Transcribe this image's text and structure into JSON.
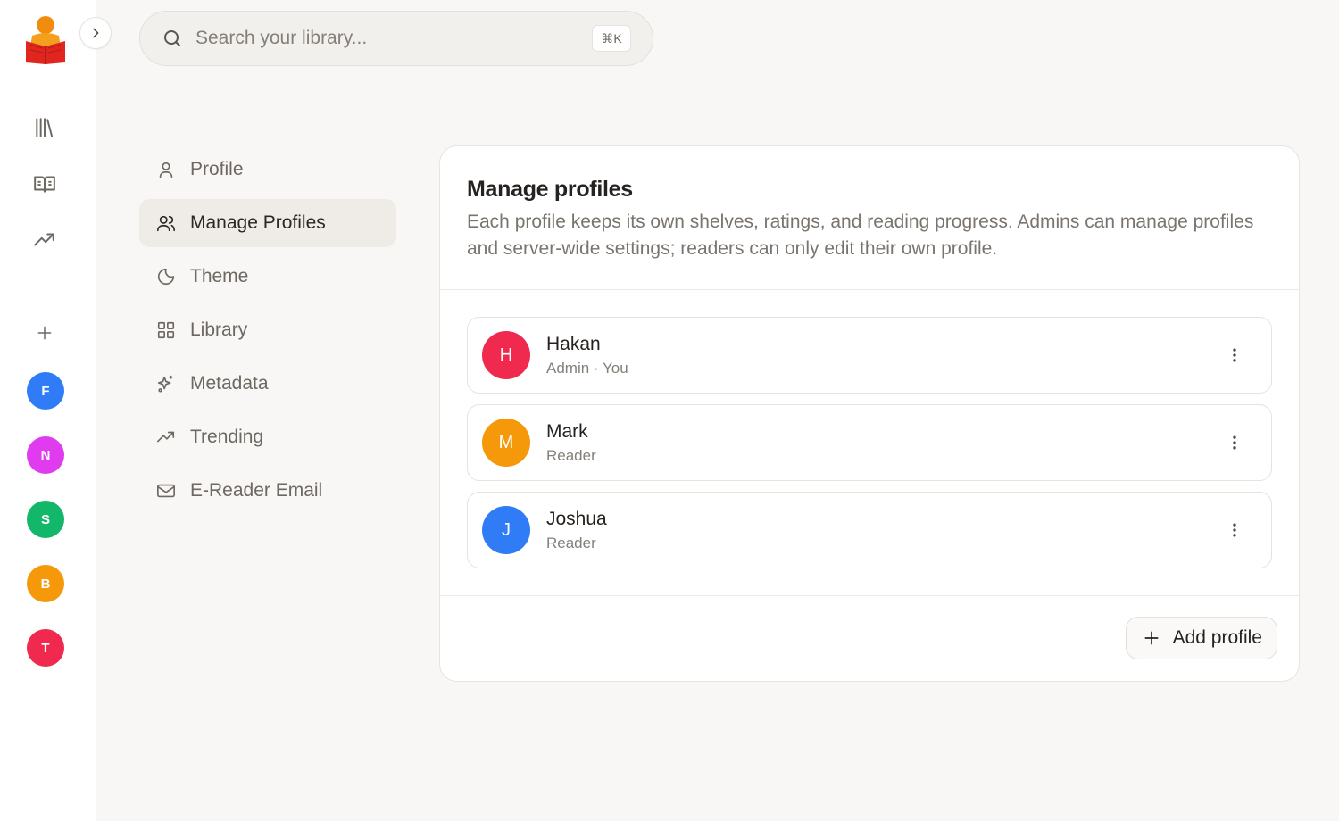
{
  "search": {
    "placeholder": "Search your library...",
    "shortcut": "⌘K"
  },
  "rail": {
    "icons": [
      "library-icon",
      "book-open-icon",
      "trending-icon",
      "plus-icon"
    ],
    "avatars": [
      {
        "initial": "F",
        "color": "#2f7cf6"
      },
      {
        "initial": "N",
        "color": "#e13bf0"
      },
      {
        "initial": "S",
        "color": "#12b76a"
      },
      {
        "initial": "B",
        "color": "#f5990b"
      },
      {
        "initial": "T",
        "color": "#f0294f"
      }
    ]
  },
  "settings_nav": [
    {
      "label": "Profile",
      "icon": "user-icon",
      "active": false
    },
    {
      "label": "Manage Profiles",
      "icon": "users-icon",
      "active": true
    },
    {
      "label": "Theme",
      "icon": "moon-icon",
      "active": false
    },
    {
      "label": "Library",
      "icon": "grid-icon",
      "active": false
    },
    {
      "label": "Metadata",
      "icon": "sparkles-icon",
      "active": false
    },
    {
      "label": "Trending",
      "icon": "trending-icon",
      "active": false
    },
    {
      "label": "E-Reader Email",
      "icon": "mail-icon",
      "active": false
    }
  ],
  "manage": {
    "title": "Manage profiles",
    "description": "Each profile keeps its own shelves, ratings, and reading progress. Admins can manage profiles and server-wide settings; readers can only edit their own profile.",
    "profiles": [
      {
        "initial": "H",
        "name": "Hakan",
        "role": "Admin · You",
        "color": "#f0294f"
      },
      {
        "initial": "M",
        "name": "Mark",
        "role": "Reader",
        "color": "#f5990b"
      },
      {
        "initial": "J",
        "name": "Joshua",
        "role": "Reader",
        "color": "#2f7cf6"
      }
    ],
    "add_label": "Add profile"
  }
}
